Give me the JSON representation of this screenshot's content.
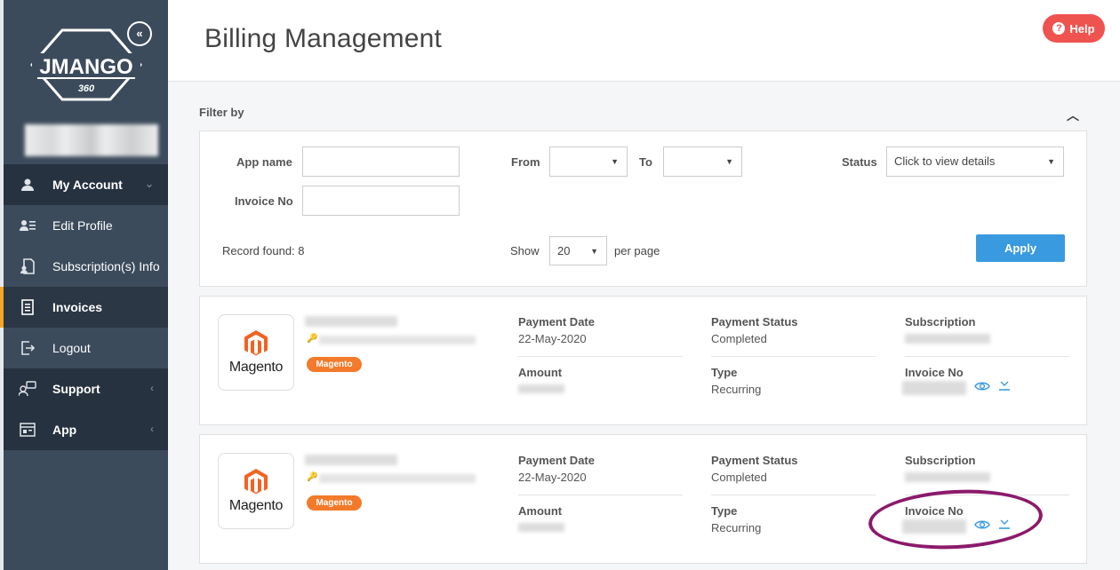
{
  "sidebar": {
    "logo_text": "JMANGO",
    "logo_sub": "360",
    "collapse": "«",
    "items": [
      {
        "label": "My Account",
        "icon": "user-icon",
        "type": "top",
        "caret": "⌄"
      },
      {
        "label": "Edit Profile",
        "icon": "profile-edit-icon",
        "type": "sub"
      },
      {
        "label": "Subscription(s) Info",
        "icon": "subscription-icon",
        "type": "sub"
      },
      {
        "label": "Invoices",
        "icon": "invoice-icon",
        "type": "active"
      },
      {
        "label": "Logout",
        "icon": "logout-icon",
        "type": "sub"
      },
      {
        "label": "Support",
        "icon": "support-icon",
        "type": "top",
        "caret": "‹"
      },
      {
        "label": "App",
        "icon": "app-icon",
        "type": "top",
        "caret": "‹"
      }
    ]
  },
  "header": {
    "title": "Billing Management",
    "help_label": "Help"
  },
  "filter": {
    "title": "Filter by",
    "app_name_label": "App name",
    "invoice_no_label": "Invoice No",
    "from_label": "From",
    "to_label": "To",
    "status_label": "Status",
    "status_value": "Click to view details",
    "record_found": "Record found: 8",
    "show_label": "Show",
    "page_size": "20",
    "per_page_label": "per page",
    "apply_label": "Apply"
  },
  "invoices": [
    {
      "platform": "Magento",
      "badge": "Magento",
      "payment_date_label": "Payment Date",
      "payment_date": "22-May-2020",
      "payment_status_label": "Payment Status",
      "payment_status": "Completed",
      "subscription_label": "Subscription",
      "amount_label": "Amount",
      "type_label": "Type",
      "type": "Recurring",
      "invoice_no_label": "Invoice No"
    },
    {
      "platform": "Magento",
      "badge": "Magento",
      "payment_date_label": "Payment Date",
      "payment_date": "22-May-2020",
      "payment_status_label": "Payment Status",
      "payment_status": "Completed",
      "subscription_label": "Subscription",
      "amount_label": "Amount",
      "type_label": "Type",
      "type": "Recurring",
      "invoice_no_label": "Invoice No"
    }
  ],
  "colors": {
    "sidebar": "#3c4b5c",
    "accent": "#3a9ae0",
    "help": "#ef5350",
    "badge": "#f27a2a",
    "annotation": "#8b1a6b"
  }
}
